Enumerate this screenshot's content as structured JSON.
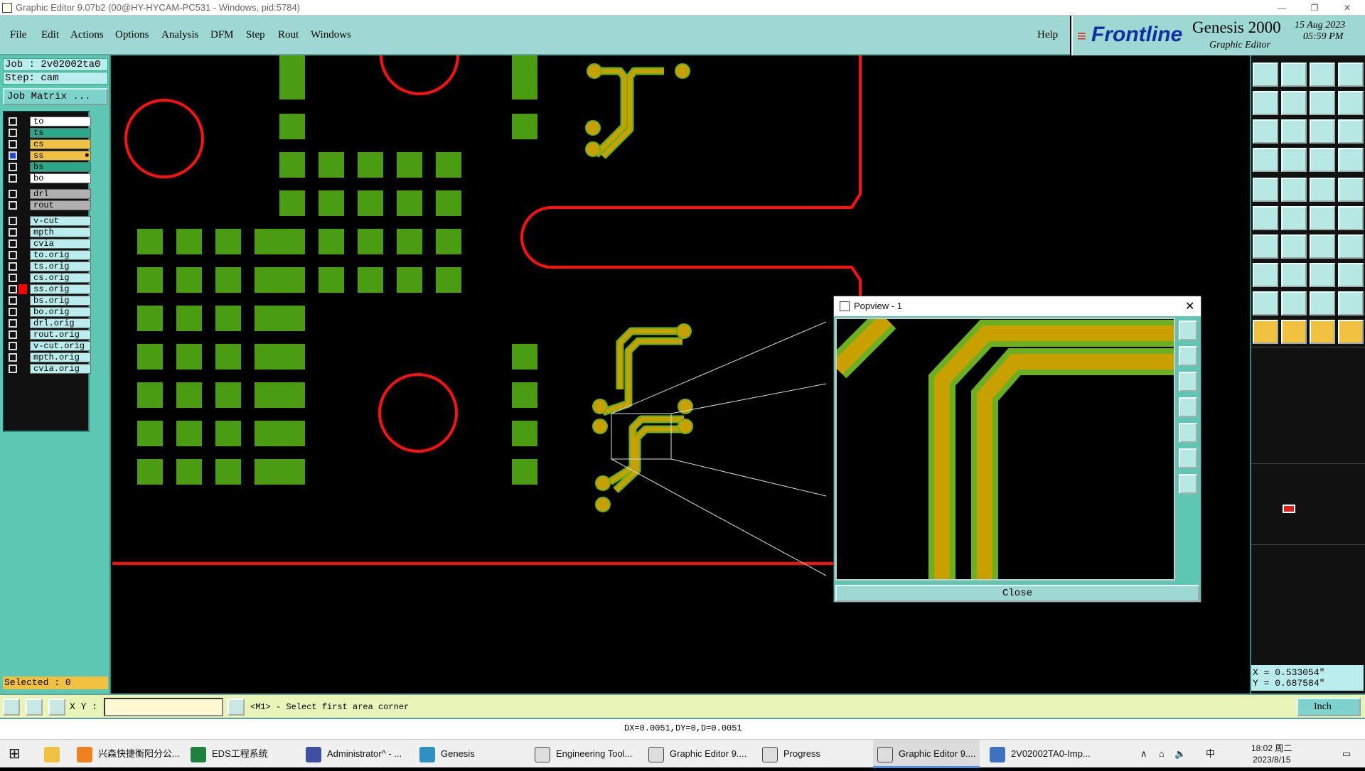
{
  "window": {
    "title": "Graphic Editor 9.07b2 (00@HY-HYCAM-PC531 - Windows, pid:5784)"
  },
  "menu": {
    "items": [
      "File",
      "Edit",
      "Actions",
      "Options",
      "Analysis",
      "DFM",
      "Step",
      "Rout",
      "Windows"
    ],
    "help": "Help"
  },
  "brand": {
    "logo": "Frontline",
    "product": "Genesis 2000",
    "subtitle": "Graphic Editor",
    "date": "15 Aug 2023",
    "time": "05:59 PM"
  },
  "job": {
    "job_label": "Job  : 2v02002ta0",
    "step_label": "Step: cam",
    "matrix_button": "Job Matrix ..."
  },
  "layers": [
    {
      "name": "to",
      "color": "#ffffff",
      "checked": false
    },
    {
      "name": "ts",
      "color": "#2aa88a",
      "checked": false
    },
    {
      "name": "cs",
      "color": "#f0c040",
      "checked": false
    },
    {
      "name": "ss",
      "color": "#f0c040",
      "checked": true,
      "mark": "■"
    },
    {
      "name": "bs",
      "color": "#2aa88a",
      "checked": false
    },
    {
      "name": "bo",
      "color": "#ffffff",
      "checked": false
    },
    {
      "name": "drl",
      "color": "#b0b0b0",
      "checked": false
    },
    {
      "name": "rout",
      "color": "#b0b0b0",
      "checked": false
    },
    {
      "name": "v-cut",
      "color": "#b9ecec",
      "checked": false
    },
    {
      "name": "mpth",
      "color": "#b9ecec",
      "checked": false
    },
    {
      "name": "cvia",
      "color": "#b9ecec",
      "checked": false
    },
    {
      "name": "to.orig",
      "color": "#b9ecec",
      "checked": false
    },
    {
      "name": "ts.orig",
      "color": "#b9ecec",
      "checked": false
    },
    {
      "name": "cs.orig",
      "color": "#b9ecec",
      "checked": false
    },
    {
      "name": "ss.orig",
      "color": "#b9ecec",
      "checked": false,
      "marker": "#ff0000"
    },
    {
      "name": "bs.orig",
      "color": "#b9ecec",
      "checked": false
    },
    {
      "name": "bo.orig",
      "color": "#b9ecec",
      "checked": false
    },
    {
      "name": "drl.orig",
      "color": "#b9ecec",
      "checked": false
    },
    {
      "name": "rout.orig",
      "color": "#b9ecec",
      "checked": false
    },
    {
      "name": "v-cut.orig",
      "color": "#b9ecec",
      "checked": false
    },
    {
      "name": "mpth.orig",
      "color": "#b9ecec",
      "checked": false
    },
    {
      "name": "cvia.orig",
      "color": "#b9ecec",
      "checked": false
    }
  ],
  "selected_label": "Selected : 0",
  "popview": {
    "title": "Popview - 1",
    "close_label": "Close"
  },
  "coords": {
    "x": "X  =  0.533054\"",
    "y": "Y  =  0.687584\""
  },
  "cmd": {
    "xy_label": "X Y :",
    "prompt": "<M1> - Select first area corner",
    "units": "Inch"
  },
  "status": {
    "delta": "DX=0.0051,DY=0,D=0.0051"
  },
  "taskbar": {
    "items": [
      "兴森快捷衡阳分公...",
      "EDS工程系统",
      "Administrator^ - ...",
      "Genesis",
      "Engineering Tool...",
      "Graphic Editor 9....",
      "Progress",
      "Graphic Editor 9....",
      "2V02002TA0-Imp..."
    ],
    "ime": "中",
    "time": "18:02 周二",
    "date": "2023/8/15"
  },
  "colors": {
    "pad": "#4a9c10",
    "trace": "#c8a000",
    "outline": "#ff1010",
    "panel": "#5dc7b4",
    "menubar": "#9dd9d2"
  }
}
